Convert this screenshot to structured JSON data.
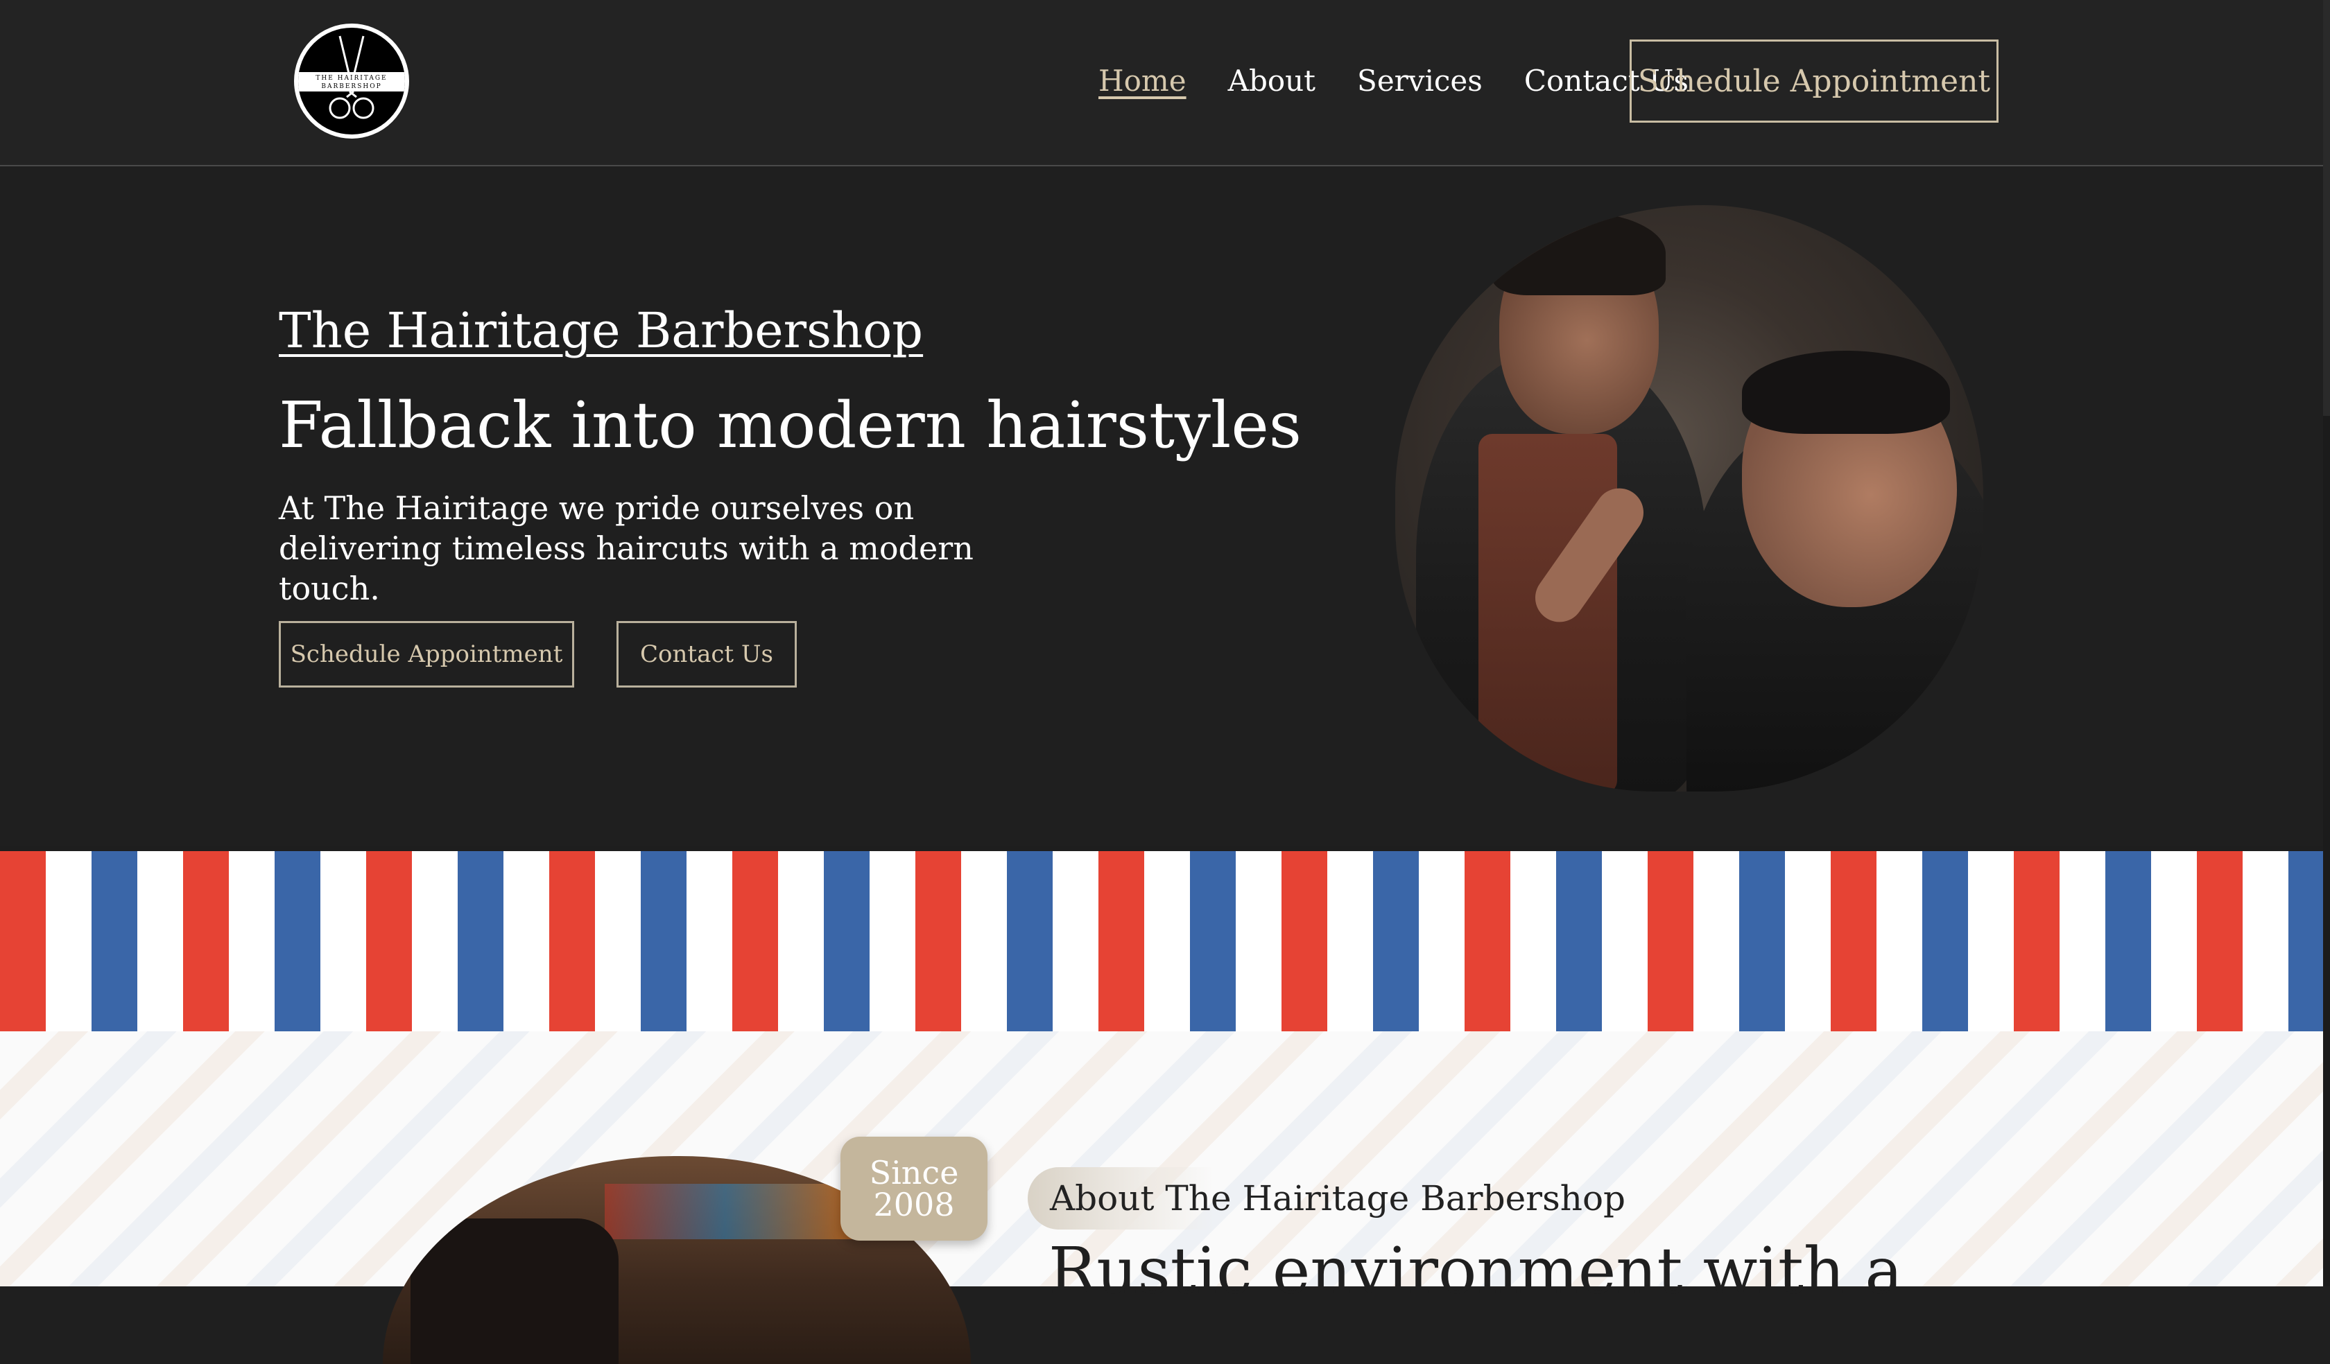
{
  "header": {
    "logo_text_top": "THE HAIRITAGE",
    "logo_text_bottom": "BARBERSHOP",
    "nav": [
      {
        "label": "Home",
        "active": true
      },
      {
        "label": "About",
        "active": false
      },
      {
        "label": "Services",
        "active": false
      },
      {
        "label": "Contact Us",
        "active": false
      }
    ],
    "cta_label": "Schedule Appointment"
  },
  "hero": {
    "brand": "The Hairitage Barbershop",
    "title": "Fallback into modern hairstyles",
    "text": "At The Hairitage we pride ourselves on delivering timeless haircuts with a modern touch.",
    "primary_button": "Schedule Appointment",
    "secondary_button": "Contact Us",
    "image_alt": "barber-cutting-hair-photo"
  },
  "about": {
    "since_label": "Since",
    "since_year": "2008",
    "pill_label": "About The Hairitage Barbershop",
    "title": "Rustic environment with a"
  },
  "colors": {
    "background_dark": "#1f1f1f",
    "accent": "#d6c8ad",
    "stripe_red": "#e64334",
    "stripe_blue": "#3a66a8",
    "badge": "#c4b69c"
  }
}
